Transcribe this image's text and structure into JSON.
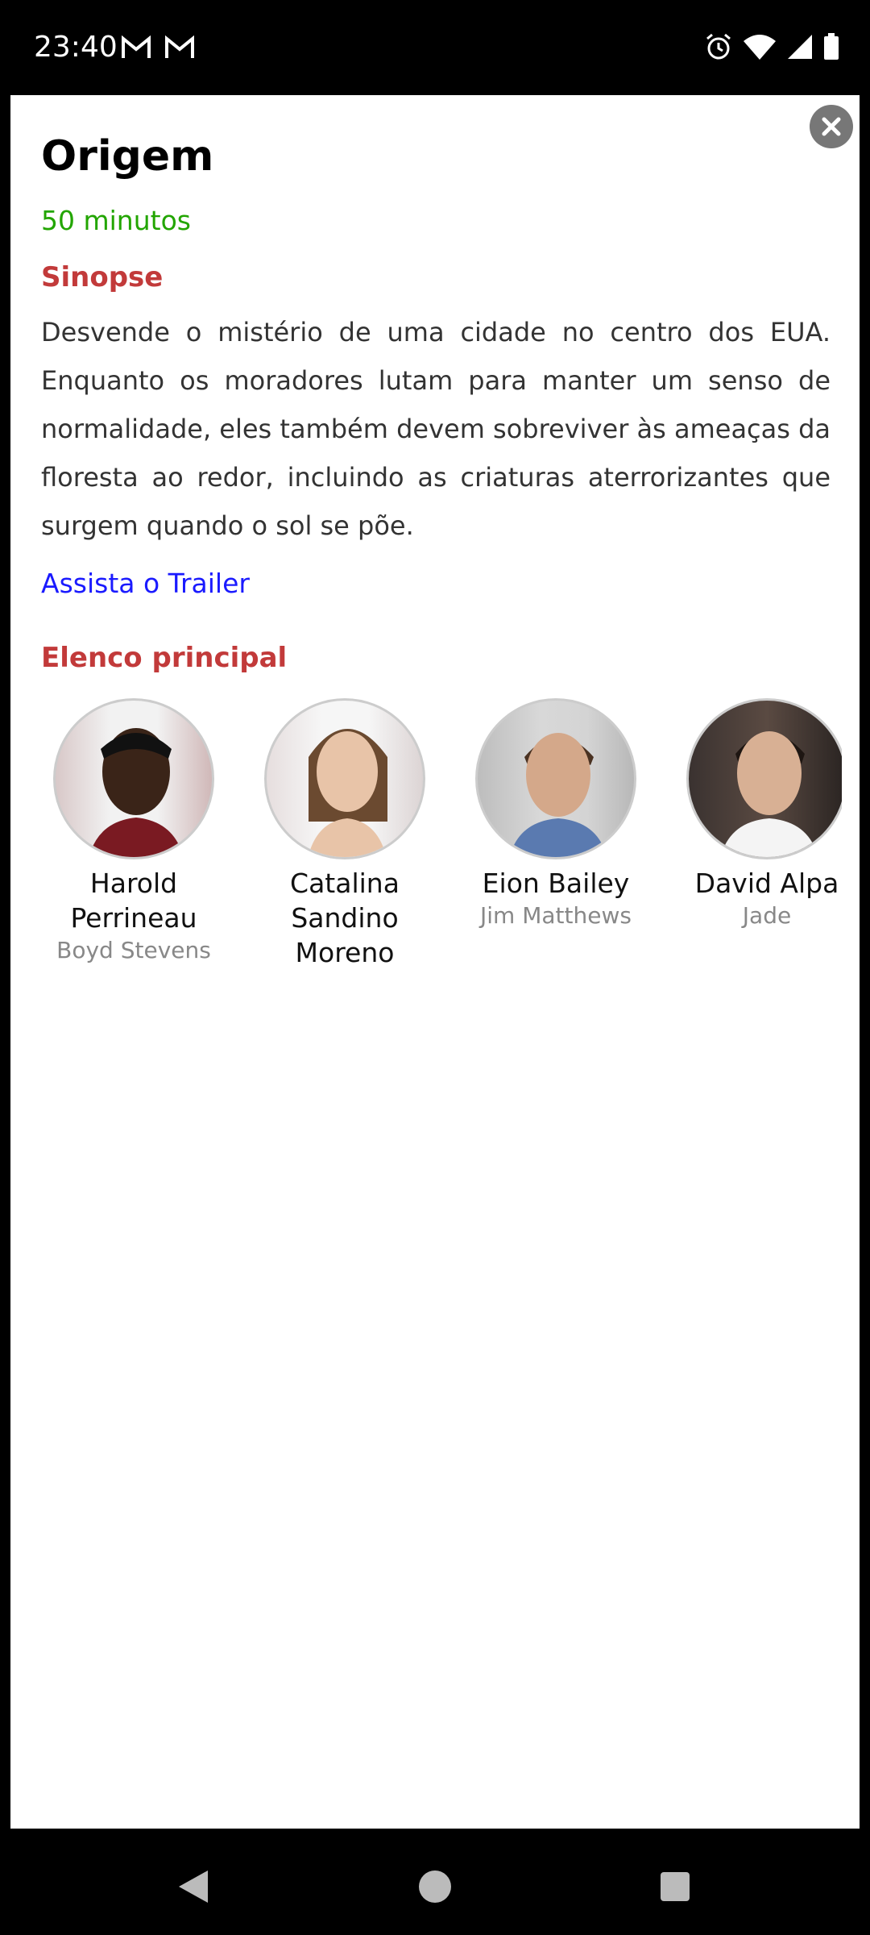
{
  "status_bar": {
    "time": "23:40",
    "icons": [
      "gmail-icon",
      "gmail-icon",
      "alarm-icon",
      "wifi-icon",
      "signal-icon",
      "battery-icon"
    ]
  },
  "details": {
    "title": "Origem",
    "duration": "50 minutos",
    "synopsis_heading": "Sinopse",
    "synopsis": "Desvende o mistério de uma cidade no centro dos EUA. Enquanto os moradores lutam para manter um senso de normalidade, eles também devem sobreviver às ameaças da floresta ao redor, incluindo as criaturas aterrorizantes que surgem quando o sol se põe.",
    "trailer_link": "Assista o Trailer",
    "cast_heading": "Elenco principal"
  },
  "cast": [
    {
      "name": "Harold Perrineau",
      "character": "Boyd Stevens"
    },
    {
      "name": "Catalina Sandino Moreno",
      "character": ""
    },
    {
      "name": "Eion Bailey",
      "character": "Jim Matthews"
    },
    {
      "name": "David Alpa",
      "character": "Jade"
    }
  ],
  "colors": {
    "duration": "#22a500",
    "heading": "#c23a3a",
    "link": "#1a1aff"
  }
}
